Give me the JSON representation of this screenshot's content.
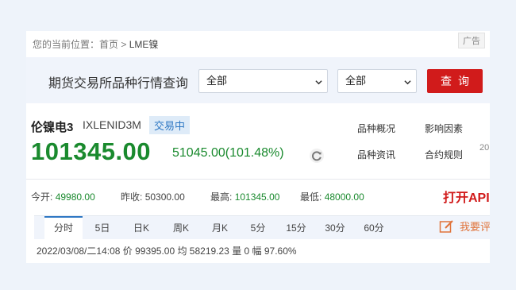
{
  "breadcrumb": {
    "prefix": "您的当前位置：首页 > ",
    "current": "LME镍"
  },
  "ad_tag": "广告",
  "query": {
    "title": "期货交易所品种行情查询",
    "exchange_select": "全部",
    "product_select": "全部",
    "button": "查询"
  },
  "product": {
    "name": "伦镍电3",
    "code": "IXLENID3M",
    "status": "交易中",
    "price": "101345.00",
    "change": "51045.00(101.48%)"
  },
  "links": [
    "品种概况",
    "影响因素",
    "品种资讯",
    "合约规则"
  ],
  "cutoff_text": "20",
  "stats": {
    "open_label": "今开:",
    "open": "49980.00",
    "prev_close_label": "昨收:",
    "prev_close": "50300.00",
    "high_label": "最高:",
    "high": "101345.00",
    "low_label": "最低:",
    "low": "48000.00"
  },
  "api_link": "打开API",
  "tabs": [
    "分时",
    "5日",
    "日K",
    "周K",
    "月K",
    "5分",
    "15分",
    "30分",
    "60分"
  ],
  "feedback": "我要评",
  "quote_line": "2022/03/08/二14:08  价 99395.00  均 58219.23  量 0  幅 97.60%",
  "colors": {
    "up_green": "#1a8a2e",
    "red": "#d11b1b",
    "blue": "#2f78c4"
  }
}
